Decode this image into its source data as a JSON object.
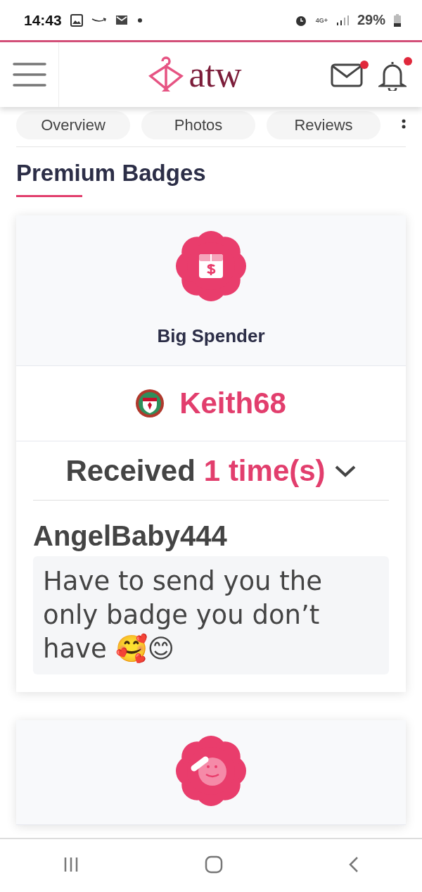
{
  "status_bar": {
    "time": "14:43",
    "network": "4G+",
    "battery": "29%"
  },
  "header": {
    "logo": "atw",
    "messages_unread": true,
    "notifications_unread": true
  },
  "tabs": [
    {
      "label": "Overview"
    },
    {
      "label": "Photos"
    },
    {
      "label": "Reviews"
    }
  ],
  "section_title": "Premium Badges",
  "badges": [
    {
      "kind": "money",
      "name": "Big Spender",
      "sender": "Keith68",
      "received_label": "Received",
      "received_count": "1 time(s)",
      "expanded": true,
      "messages": [
        {
          "author": "AngelBaby444",
          "text": "Have to send you the only badge you don’t have 🥰😊"
        }
      ]
    },
    {
      "kind": "salute"
    }
  ]
}
